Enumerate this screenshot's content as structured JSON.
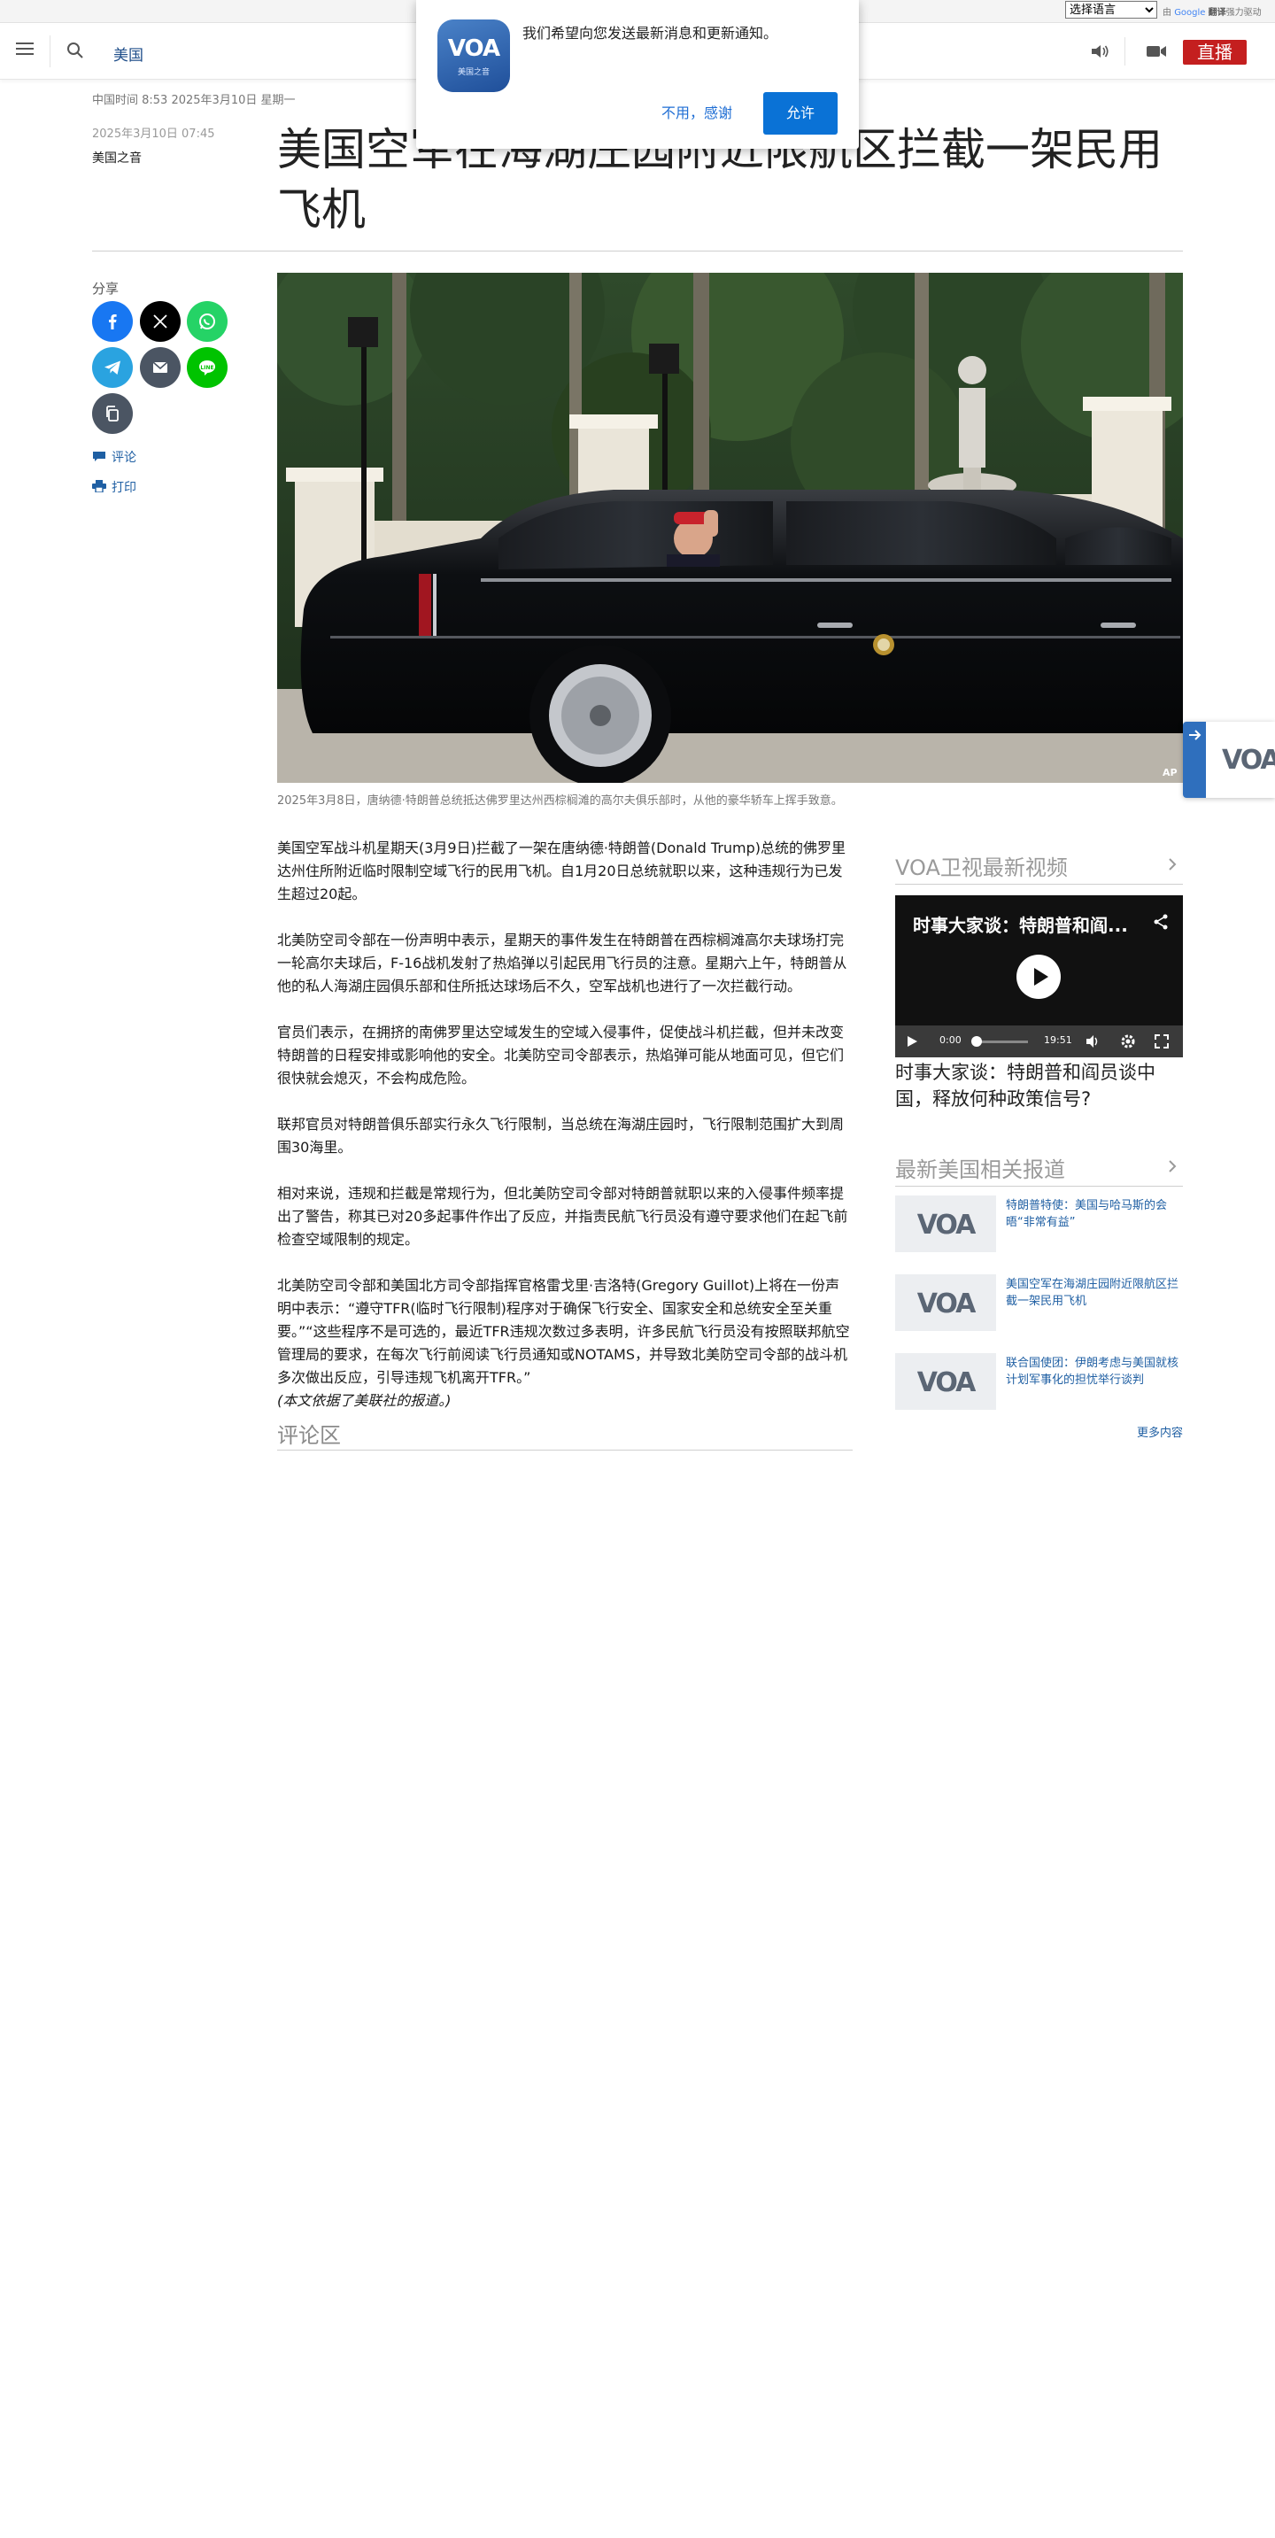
{
  "translate": {
    "select_value": "选择语言",
    "powered_prefix": "由",
    "powered_google": "Google",
    "powered_suffix": "翻译",
    "powered_tail": "强力驱动"
  },
  "header": {
    "section": "美国",
    "live_label": "直播"
  },
  "notification": {
    "message": "我们希望向您发送最新消息和更新通知。",
    "deny_label": "不用，感谢",
    "allow_label": "允许",
    "logo_text": "VOA",
    "logo_sub": "美国之音"
  },
  "dateline": "中国时间 8:53 2025年3月10日 星期一",
  "article": {
    "date": "2025年3月10日 07:45",
    "author": "美国之音",
    "title": "美国空军在海湖庄园附近限航区拦截一架民用飞机",
    "caption": "2025年3月8日，唐纳德·特朗普总统抵达佛罗里达州西棕榈滩的高尔夫俱乐部时，从他的豪华轿车上挥手致意。",
    "image_credit": "AP",
    "paragraphs": [
      "美国空军战斗机星期天(3月9日)拦截了一架在唐纳德·特朗普(Donald Trump)总统的佛罗里达州住所附近临时限制空域飞行的民用飞机。自1月20日总统就职以来，这种违规行为已发生超过20起。",
      "北美防空司令部在一份声明中表示，星期天的事件发生在特朗普在西棕榈滩高尔夫球场打完一轮高尔夫球后，F-16战机发射了热焰弹以引起民用飞行员的注意。星期六上午，特朗普从他的私人海湖庄园俱乐部和住所抵达球场后不久，空军战机也进行了一次拦截行动。",
      "官员们表示，在拥挤的南佛罗里达空域发生的空域入侵事件，促使战斗机拦截，但并未改变特朗普的日程安排或影响他的安全。北美防空司令部表示，热焰弹可能从地面可见，但它们很快就会熄灭，不会构成危险。",
      "联邦官员对特朗普俱乐部实行永久飞行限制，当总统在海湖庄园时，飞行限制范围扩大到周围30海里。",
      "相对来说，违规和拦截是常规行为，但北美防空司令部对特朗普就职以来的入侵事件频率提出了警告，称其已对20多起事件作出了反应，并指责民航飞行员没有遵守要求他们在起飞前检查空域限制的规定。",
      "北美防空司令部和美国北方司令部指挥官格雷戈里·吉洛特(Gregory Guillot)上将在一份声明中表示：“遵守TFR(临时飞行限制)程序对于确保飞行安全、国家安全和总统安全至关重要。”“这些程序不是可选的，最近TFR违规次数过多表明，许多民航飞行员没有按照联邦航空管理局的要求，在每次飞行前阅读飞行员通知或NOTAMS，并导致北美防空司令部的战斗机多次做出反应，引导违规飞机离开TFR。”"
    ],
    "note": "(本文依据了美联社的报道。)"
  },
  "share": {
    "label": "分享",
    "comment_label": "评论",
    "print_label": "打印"
  },
  "comments": {
    "title": "评论区"
  },
  "sidebar": {
    "video_heading": "VOA卫视最新视频",
    "video_title": "时事大家谈：特朗普和阎...",
    "video_time_current": "0:00",
    "video_time_total": "19:51",
    "video_caption": "时事大家谈：特朗普和阎员谈中国，释放何种政策信号?",
    "related_heading": "最新美国相关报道",
    "related": [
      {
        "title": "特朗普特使：美国与哈马斯的会晤“非常有益”",
        "thumb": "VOA"
      },
      {
        "title": "美国空军在海湖庄园附近限航区拦截一架民用飞机",
        "thumb": "VOA"
      },
      {
        "title": "联合国使团：伊朗考虑与美国就核计划军事化的担忧举行谈判",
        "thumb": "VOA"
      }
    ],
    "more_label": "更多内容"
  },
  "float_tab": {
    "logo": "VOA"
  },
  "colors": {
    "accent_blue": "#1f5fa3",
    "live_red": "#c41f1f",
    "allow_blue": "#0a72d6",
    "facebook": "#1877f2",
    "x": "#000000",
    "whatsapp": "#25d366",
    "telegram": "#2aa3e0",
    "email": "#4b5563",
    "line": "#00c300",
    "copy": "#4b5563"
  },
  "icons": [
    "hamburger-icon",
    "search-icon",
    "speaker-icon",
    "video-camera-icon",
    "facebook-icon",
    "x-icon",
    "whatsapp-icon",
    "telegram-icon",
    "email-icon",
    "line-icon",
    "copy-icon",
    "comment-icon",
    "print-icon",
    "share-icon",
    "play-icon",
    "chevron-right-icon"
  ]
}
